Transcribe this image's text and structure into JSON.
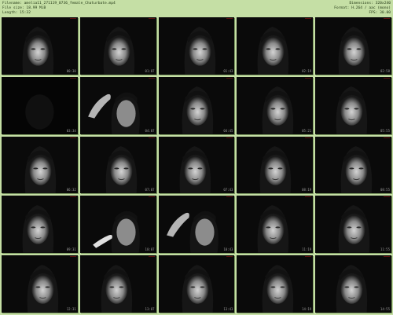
{
  "header": {
    "filename": "Filename: amelia11_271119_0736_female_Chaturbate.mp4",
    "filesize": "File size: 18.99 MiB",
    "length": "Length: 15:32",
    "dimensions": "Dimensions: 320x240",
    "format": "Format: H.264 / aac (mono)",
    "fps": "FPS: 30.00"
  },
  "thumbnails": [
    {
      "time": "00:30",
      "scene": "face"
    },
    {
      "time": "01:07",
      "scene": "face"
    },
    {
      "time": "01:43",
      "scene": "face"
    },
    {
      "time": "02:19",
      "scene": "face"
    },
    {
      "time": "02:58",
      "scene": "face"
    },
    {
      "time": "03:34",
      "scene": "dark"
    },
    {
      "time": "04:07",
      "scene": "hand"
    },
    {
      "time": "04:45",
      "scene": "face"
    },
    {
      "time": "05:21",
      "scene": "face"
    },
    {
      "time": "05:55",
      "scene": "face"
    },
    {
      "time": "06:32",
      "scene": "face"
    },
    {
      "time": "07:07",
      "scene": "face"
    },
    {
      "time": "07:43",
      "scene": "face"
    },
    {
      "time": "08:19",
      "scene": "face"
    },
    {
      "time": "08:55",
      "scene": "face"
    },
    {
      "time": "09:31",
      "scene": "face"
    },
    {
      "time": "10:07",
      "scene": "hand"
    },
    {
      "time": "10:43",
      "scene": "hand"
    },
    {
      "time": "11:19",
      "scene": "face"
    },
    {
      "time": "11:55",
      "scene": "face"
    },
    {
      "time": "12:31",
      "scene": "face"
    },
    {
      "time": "13:07",
      "scene": "face"
    },
    {
      "time": "13:43",
      "scene": "face"
    },
    {
      "time": "14:19",
      "scene": "face"
    },
    {
      "time": "14:55",
      "scene": "face"
    }
  ]
}
